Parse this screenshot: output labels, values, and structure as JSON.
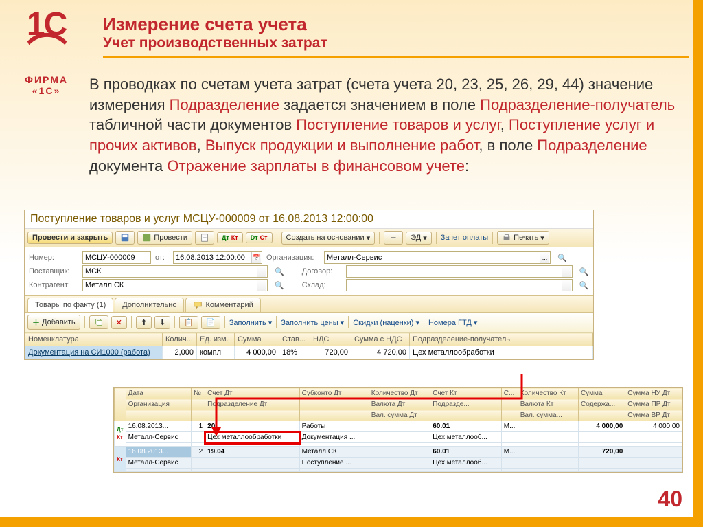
{
  "logo": {
    "brand": "1С",
    "sub": "ФИРМА «1С»"
  },
  "page_number": "40",
  "title": {
    "main": "Измерение счета учета",
    "sub": "Учет производственных затрат"
  },
  "body": {
    "p1a": "В проводках по счетам учета затрат (счета учета 20, 23, 25, 26, 29, 44) значение измерения ",
    "hl1": "Подразделение",
    "p1b": " задается значением в поле ",
    "hl2": "Подразделение-получатель",
    "p1c": " табличной части документов ",
    "hl3": "Поступление товаров и услуг",
    "p1d": ", ",
    "hl4": "Поступление услуг и прочих активов",
    "p1e": ", ",
    "hl5": "Выпуск продукции и выполнение работ",
    "p1f": ", в поле ",
    "hl6": "Подразделение",
    "p1g": " документа ",
    "hl7": "Отражение зарплаты в финансовом учете",
    "p1h": ":"
  },
  "win": {
    "title": "Поступление товаров и услуг МСЦУ-000009 от 16.08.2013 12:00:00",
    "buttons": {
      "post_close": "Провести и закрыть",
      "post": "Провести",
      "create_based": "Создать на основании",
      "ed": "ЭД",
      "payment": "Зачет оплаты",
      "print": "Печать"
    },
    "form": {
      "number_label": "Номер:",
      "number": "МСЦУ-000009",
      "date_label": "от:",
      "date": "16.08.2013 12:00:00",
      "org_label": "Организация:",
      "org": "Металл-Сервис",
      "supplier_label": "Поставщик:",
      "supplier": "МСК",
      "contract_label": "Договор:",
      "contract": "",
      "counterparty_label": "Контрагент:",
      "counterparty": "Металл СК",
      "warehouse_label": "Склад:",
      "warehouse": ""
    },
    "tabs": {
      "t1": "Товары по факту (1)",
      "t2": "Дополнительно",
      "t3": "Комментарий"
    },
    "subbar": {
      "add": "Добавить",
      "fill": "Заполнить",
      "fill_prices": "Заполнить цены",
      "discounts": "Скидки (наценки)",
      "gtd": "Номера ГТД"
    },
    "cols": {
      "nomen": "Номенклатура",
      "qty": "Колич...",
      "unit": "Ед. изм.",
      "sum": "Сумма",
      "rate": "Став...",
      "vat": "НДС",
      "sum_vat": "Сумма с НДС",
      "dept": "Подразделение-получатель"
    },
    "row": {
      "nomen": "Документация на СИ1000 (работа)",
      "qty": "2,000",
      "unit": "компл",
      "sum": "4 000,00",
      "rate": "18%",
      "vat": "720,00",
      "sum_vat": "4 720,00",
      "dept": "Цех металлообработки"
    }
  },
  "prov": {
    "hdr": {
      "date": "Дата",
      "num": "№",
      "acc_dt": "Счет Дт",
      "sub_dt": "Субконто Дт",
      "qty_dt": "Количество Дт",
      "acc_kt": "Счет Кт",
      "s": "С...",
      "qty_kt": "Количество Кт",
      "sum": "Сумма",
      "sum_nu": "Сумма НУ Дт",
      "org": "Организация",
      "dept_dt": "Подразделение Дт",
      "cur_dt": "Валюта Дт",
      "dept_kt": "Подразде...",
      "cur_kt": "Валюта Кт",
      "cont": "Содержа...",
      "sum_pr": "Сумма ПР Дт",
      "valsum_dt": "Вал. сумма Дт",
      "valsum_kt": "Вал. сумма...",
      "sum_vr": "Сумма ВР Дт"
    },
    "r1": {
      "date": "16.08.2013...",
      "num": "1",
      "acc_dt": "20",
      "sub_dt": "Работы",
      "acc_kt": "60.01",
      "s": "М...",
      "sum": "4 000,00",
      "sum_nu": "4 000,00",
      "org": "Металл-Сервис",
      "dept_dt": "Цех металлообработки",
      "sub2": "Документация ...",
      "dept_kt": "Цех металлооб..."
    },
    "r2": {
      "date": "16.08.2013...",
      "num": "2",
      "acc_dt": "19.04",
      "sub_dt": "Металл СК",
      "acc_kt": "60.01",
      "s": "М...",
      "sum": "720,00",
      "org": "Металл-Сервис",
      "sub2": "Поступление ...",
      "dept_kt": "Цех металлооб..."
    }
  }
}
